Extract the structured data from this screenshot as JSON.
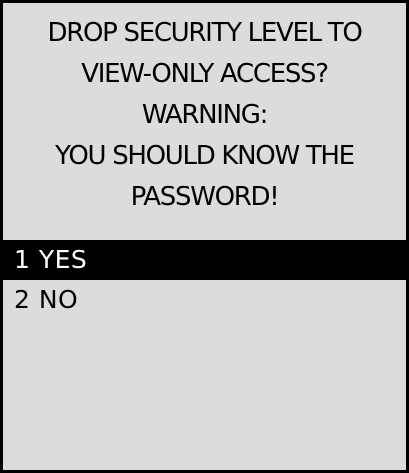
{
  "prompt": {
    "lines": [
      "DROP SECURITY LEVEL TO",
      "VIEW-ONLY ACCESS?",
      "WARNING:",
      "YOU SHOULD KNOW THE",
      "PASSWORD!"
    ]
  },
  "menu": {
    "items": [
      {
        "label": "1 YES",
        "selected": true
      },
      {
        "label": "2 NO",
        "selected": false
      }
    ]
  },
  "colors": {
    "background": "#dcdcdc",
    "text": "#000000",
    "highlight_background": "#000000",
    "highlight_text": "#ffffff"
  }
}
